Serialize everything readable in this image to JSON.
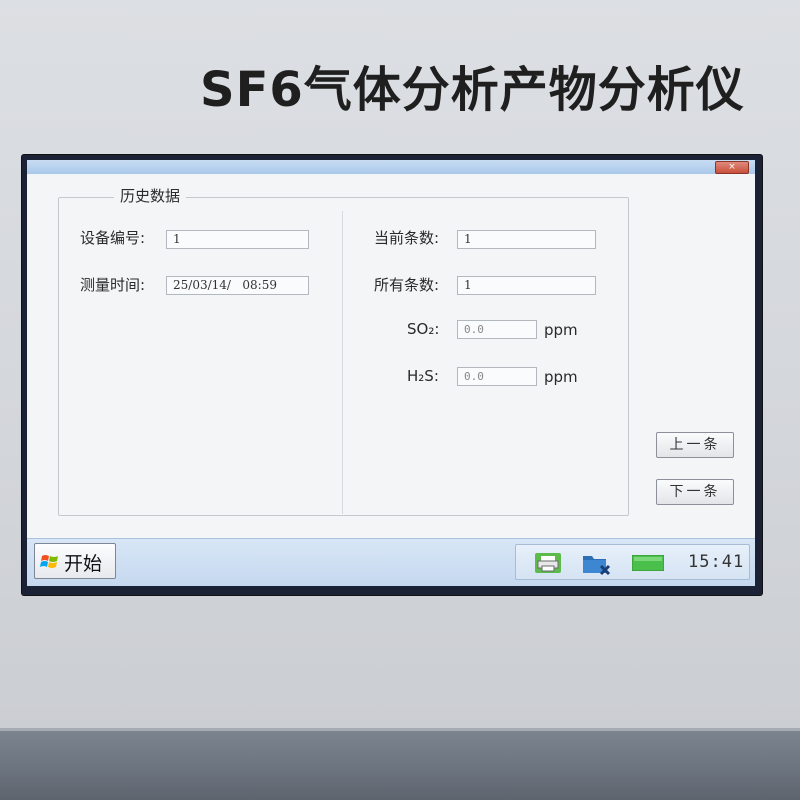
{
  "device": {
    "title": "SF6气体分析产物分析仪"
  },
  "window": {
    "close_glyph": "×",
    "group_title": "历史数据"
  },
  "left_panel": {
    "device_id_label": "设备编号:",
    "device_id_value": "1",
    "measure_time_label": "测量时间:",
    "measure_time_value": "25/03/14/   08:59"
  },
  "right_panel": {
    "current_count_label": "当前条数:",
    "current_count_value": "1",
    "total_count_label": "所有条数:",
    "total_count_value": "1",
    "so2_label": "SO₂:",
    "so2_value": "0.0",
    "so2_unit": "ppm",
    "h2s_label": "H₂S:",
    "h2s_value": "0.0",
    "h2s_unit": "ppm"
  },
  "buttons": {
    "prev_label": "上一条",
    "next_label": "下一条"
  },
  "taskbar": {
    "start_label": "开始",
    "tray_icons": [
      "printer-icon",
      "folder-remove-icon",
      "battery-icon"
    ],
    "clock": "15:41"
  },
  "colors": {
    "window_bg": "#f4f5f7",
    "taskbar_bg": "#c5d8ef",
    "battery_green": "#4bbf4b"
  }
}
